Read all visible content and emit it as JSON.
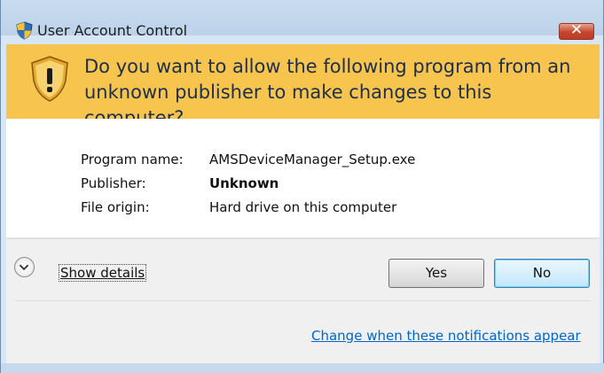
{
  "window": {
    "title": "User Account Control",
    "close_glyph": "✕",
    "icons": [
      "uac-shield-icon",
      "warning-shield-icon",
      "chevron-down-icon",
      "close-icon"
    ]
  },
  "banner": {
    "line1": "Do you want to allow the following program from an",
    "line2": "unknown publisher to make changes to this computer?",
    "color": "#f7c44d"
  },
  "program": {
    "rows": [
      {
        "label": "Program name:",
        "value": "AMSDeviceManager_Setup.exe"
      },
      {
        "label": "Publisher:",
        "value": "Unknown"
      },
      {
        "label": "File origin:",
        "value": "Hard drive on this computer"
      }
    ]
  },
  "actions": {
    "show_details": "Show details",
    "yes": "Yes",
    "no": "No",
    "notifications_link": "Change when these notifications appear"
  },
  "colors": {
    "title_bar": "#bcd2ea",
    "close_button": "#c6462d",
    "link": "#0066cc"
  }
}
